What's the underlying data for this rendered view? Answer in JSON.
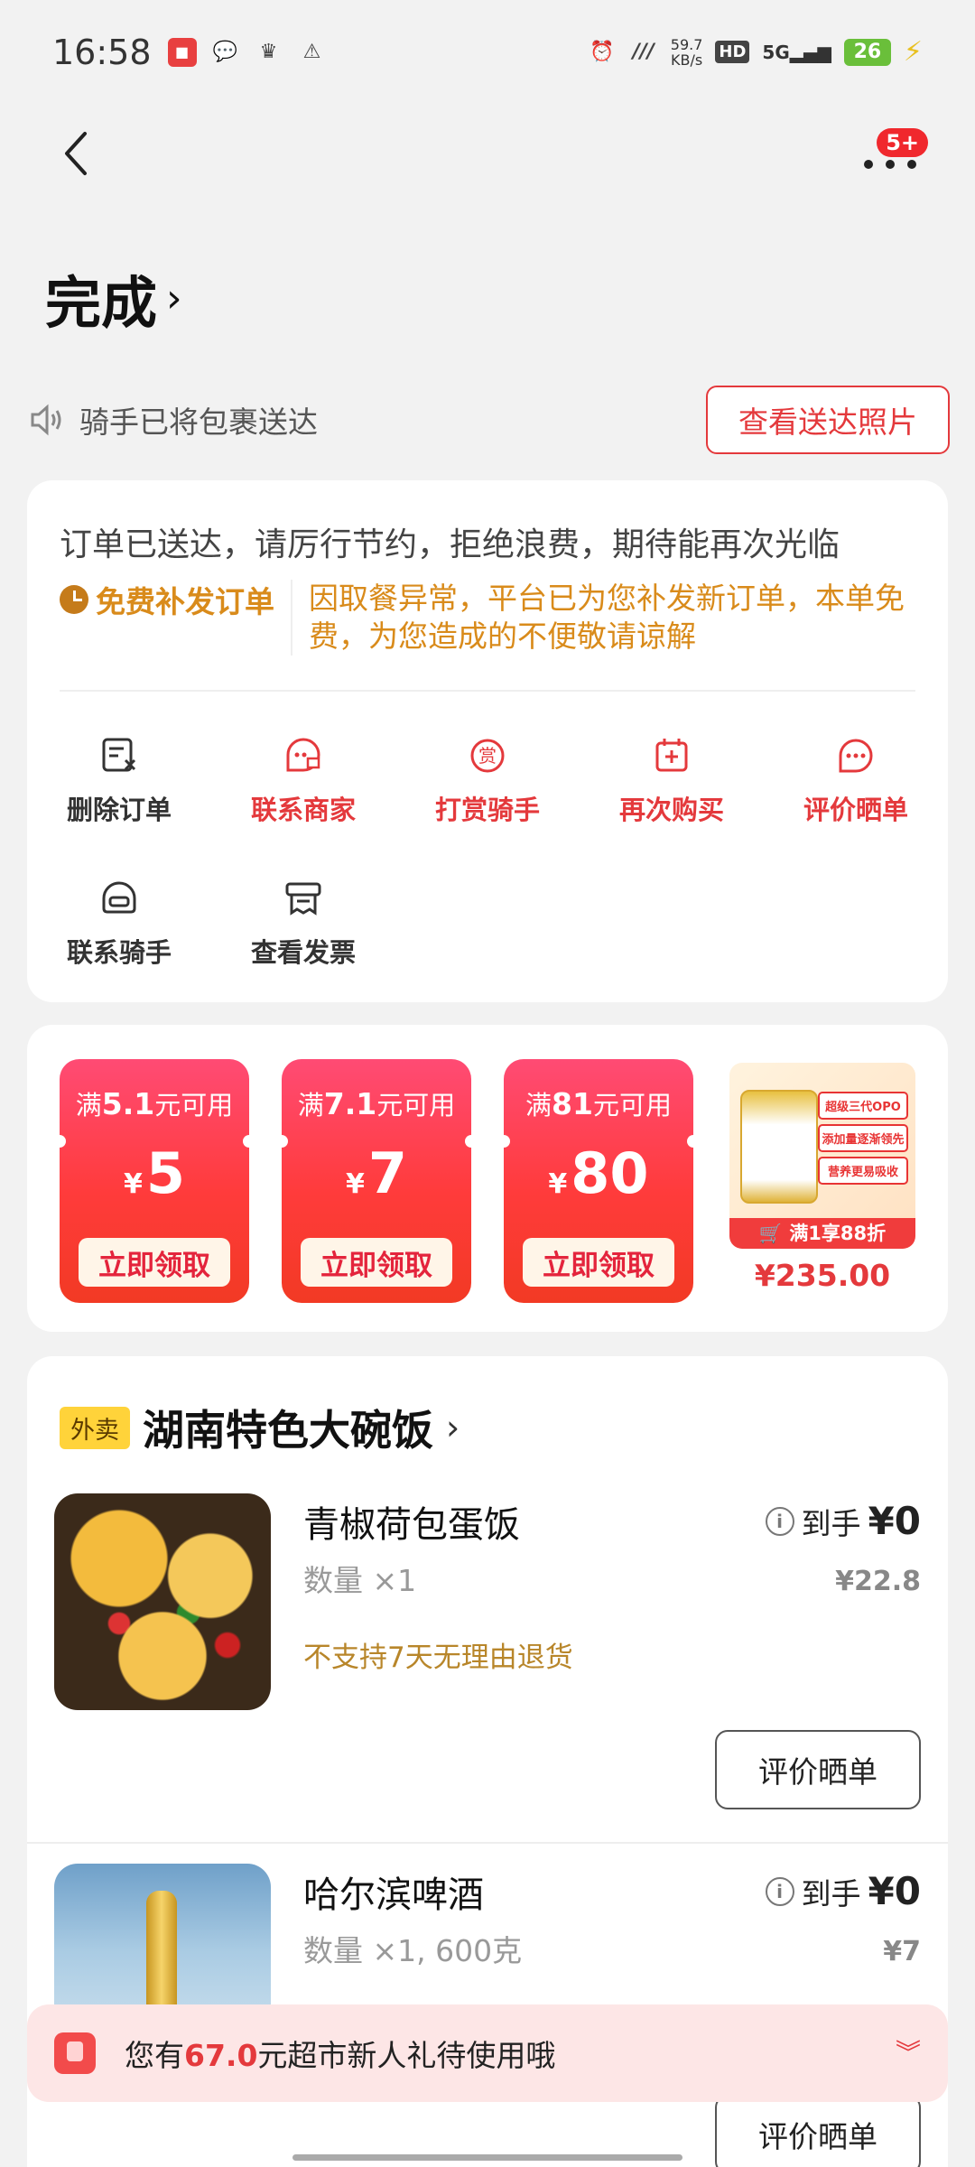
{
  "status": {
    "time": "16:58",
    "net_speed_value": "59.7",
    "net_speed_unit": "KB/s",
    "hd": "HD",
    "signal": "5G",
    "battery": "26"
  },
  "nav": {
    "more_badge": "5+"
  },
  "page_title": "完成",
  "rider_msg": "骑手已将包裹送达",
  "view_photo": "查看送达照片",
  "notice": "订单已送达，请厉行节约，拒绝浪费，期待能再次光临",
  "reissue": {
    "tag": "免费补发订单",
    "text": "因取餐异常，平台已为您补发新订单，本单免费，为您造成的不便敬请谅解"
  },
  "actions": [
    {
      "label": "删除订单",
      "icon": "delete-order-icon",
      "accent": false
    },
    {
      "label": "联系商家",
      "icon": "contact-shop-icon",
      "accent": true
    },
    {
      "label": "打赏骑手",
      "icon": "tip-icon",
      "accent": true
    },
    {
      "label": "再次购买",
      "icon": "rebuy-icon",
      "accent": true
    },
    {
      "label": "评价晒单",
      "icon": "review-icon",
      "accent": true
    },
    {
      "label": "联系骑手",
      "icon": "helmet-icon",
      "accent": false
    },
    {
      "label": "查看发票",
      "icon": "invoice-icon",
      "accent": false
    }
  ],
  "coupons": [
    {
      "cond_pre": "满",
      "cond_num": "5.1",
      "cond_post": "元可用",
      "currency": "¥",
      "amount": "5",
      "btn": "立即领取"
    },
    {
      "cond_pre": "满",
      "cond_num": "7.1",
      "cond_post": "元可用",
      "currency": "¥",
      "amount": "7",
      "btn": "立即领取"
    },
    {
      "cond_pre": "满",
      "cond_num": "81",
      "cond_post": "元可用",
      "currency": "¥",
      "amount": "80",
      "btn": "立即领取"
    }
  ],
  "promo": {
    "tags": [
      "超级三代OPO",
      "添加量逐渐领先",
      "营养更易吸收"
    ],
    "discount": "满1享88折",
    "price": "¥235.00"
  },
  "shop": {
    "tag": "外卖",
    "name": "湖南特色大碗饭"
  },
  "items": [
    {
      "name": "青椒荷包蛋饭",
      "qty": "数量 ×1",
      "note": "不支持7天无理由退货",
      "price_label": "到手",
      "price": "¥0",
      "orig": "¥22.8",
      "review": "评价晒单"
    },
    {
      "name": "哈尔滨啤酒",
      "qty": "数量 ×1, 600克",
      "price_label": "到手",
      "price": "¥0",
      "orig": "¥7",
      "review": "评价晒单"
    }
  ],
  "banner": {
    "pre": "您有",
    "amount": "67.0",
    "post": "元超市新人礼待使用哦"
  }
}
